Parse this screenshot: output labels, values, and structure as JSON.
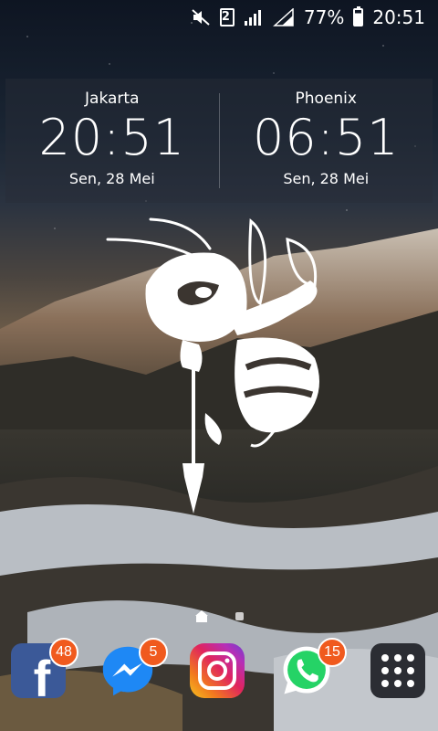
{
  "status_bar": {
    "sim_slot": "2",
    "battery_percent": "77%",
    "time": "20:51",
    "icons": [
      "mute-icon",
      "sim-icon",
      "signal-icon",
      "signal-icon",
      "battery-icon"
    ]
  },
  "world_clock": {
    "cities": [
      {
        "city": "Jakarta",
        "time": "20:51",
        "date": "Sen, 28 Mei"
      },
      {
        "city": "Phoenix",
        "time": "06:51",
        "date": "Sen, 28 Mei"
      }
    ]
  },
  "home_screen": {
    "pages": 2,
    "current_page": 1
  },
  "dock": {
    "apps": [
      {
        "name": "facebook",
        "icon": "facebook-icon",
        "badge": "48"
      },
      {
        "name": "messenger",
        "icon": "messenger-icon",
        "badge": "5"
      },
      {
        "name": "instagram",
        "icon": "instagram-icon",
        "badge": ""
      },
      {
        "name": "whatsapp",
        "icon": "whatsapp-icon",
        "badge": "15"
      },
      {
        "name": "apps",
        "icon": "app-drawer-icon",
        "badge": ""
      }
    ]
  },
  "colors": {
    "badge": "#f05a1e",
    "facebook": "#3b5998",
    "messenger": "#1e88f5",
    "whatsapp": "#25d366"
  }
}
